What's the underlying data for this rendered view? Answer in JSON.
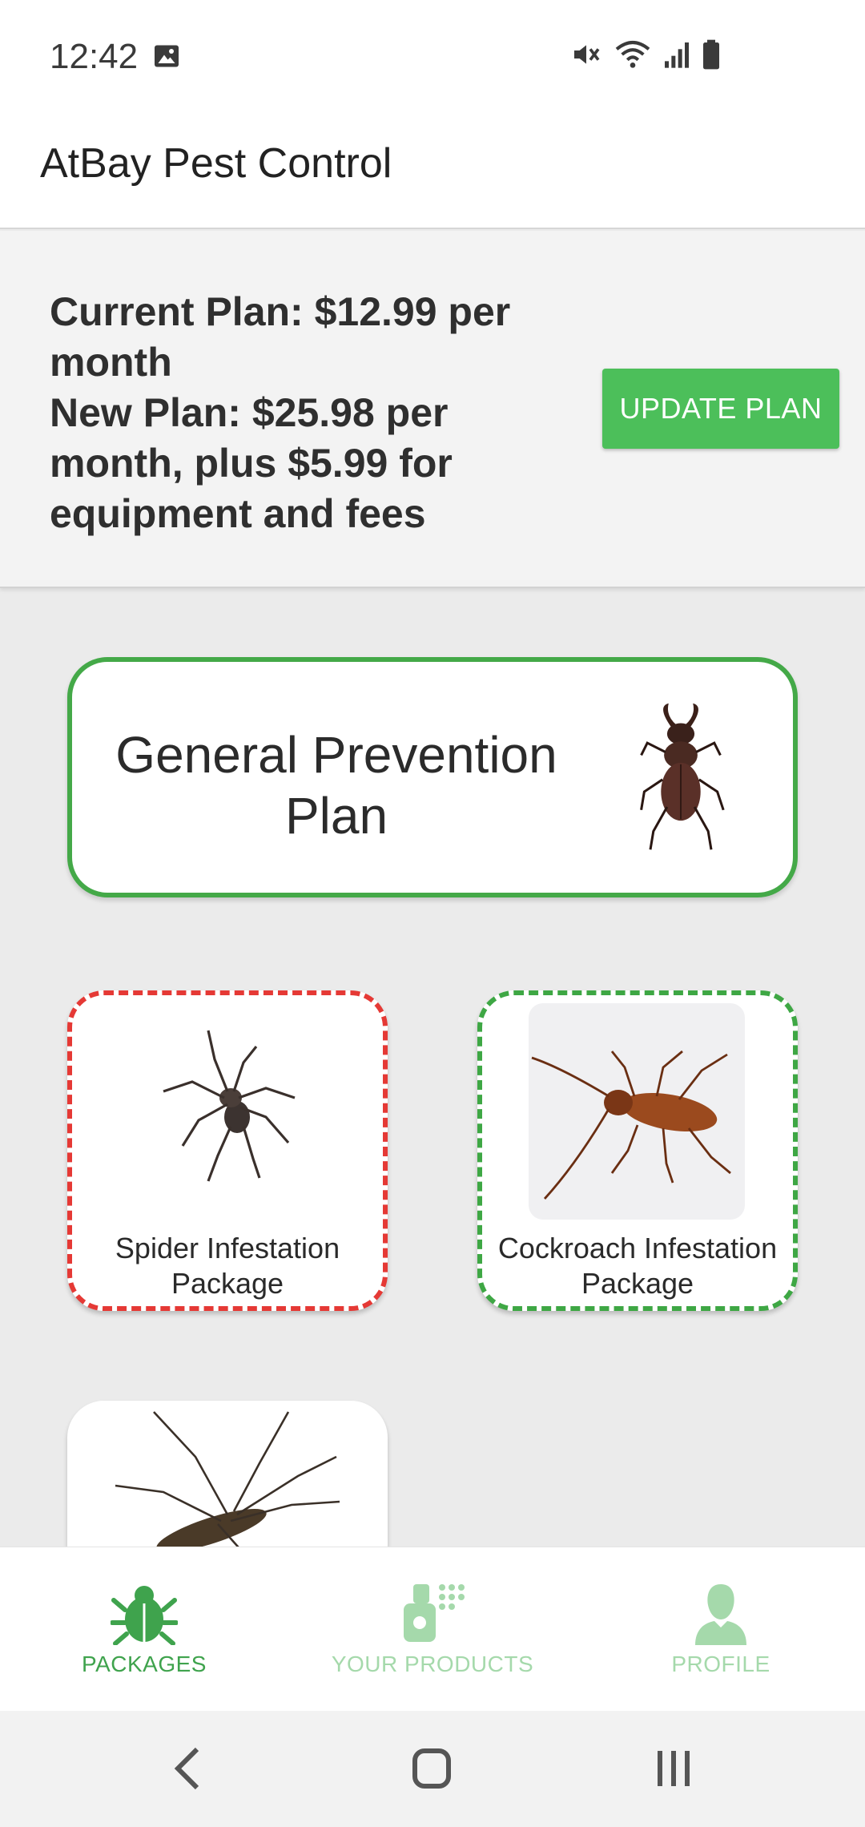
{
  "status_bar": {
    "time": "12:42"
  },
  "app_bar": {
    "title": "AtBay Pest Control"
  },
  "plan_banner": {
    "current_plan": "Current Plan: $12.99 per month",
    "new_plan": "New Plan: $25.98 per month, plus $5.99 for equipment and fees",
    "update_button": "UPDATE PLAN"
  },
  "general_plan": {
    "title_line1": "General Prevention",
    "title_line2": "Plan"
  },
  "packages": [
    {
      "label_line1": "Spider Infestation",
      "label_line2": "Package",
      "border_color": "#e53935",
      "icon": "spider-image"
    },
    {
      "label_line1": "Cockroach Infestation",
      "label_line2": "Package",
      "border_color": "#3ea744",
      "icon": "cockroach-image"
    },
    {
      "icon": "mosquito-image"
    }
  ],
  "bottom_nav": {
    "items": [
      {
        "label": "PACKAGES",
        "icon": "bug-icon",
        "active": true
      },
      {
        "label": "YOUR PRODUCTS",
        "icon": "spray-icon",
        "active": false
      },
      {
        "label": "PROFILE",
        "icon": "person-icon",
        "active": false
      }
    ]
  },
  "colors": {
    "accent_green": "#4cbf5a",
    "active_nav": "#3fa34d",
    "inactive_nav": "#a5d9ab"
  }
}
